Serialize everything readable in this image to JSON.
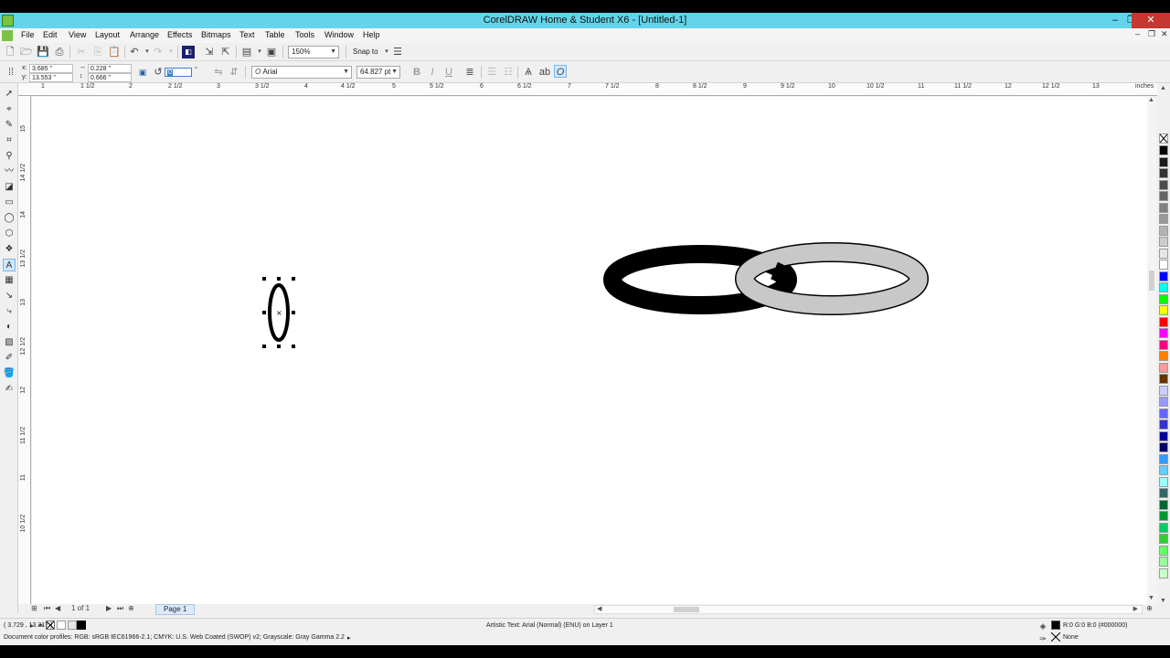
{
  "window": {
    "title": "CorelDRAW Home & Student X6 - [Untitled-1]",
    "minimize": "–",
    "restore": "❐",
    "close": "✕"
  },
  "menu": {
    "items": [
      "File",
      "Edit",
      "View",
      "Layout",
      "Arrange",
      "Effects",
      "Bitmaps",
      "Text",
      "Table",
      "Tools",
      "Window",
      "Help"
    ],
    "doc_minimize": "–",
    "doc_restore": "❐",
    "doc_close": "✕"
  },
  "standard_toolbar": {
    "zoom_level": "150%",
    "snap_to": "Snap to"
  },
  "property_bar": {
    "x": "3.685 \"",
    "y": "13.553 \"",
    "width": "0.228 \"",
    "height": "0.666 \"",
    "rotation": "0",
    "rotation_unit": "°",
    "font_name": "Arial",
    "font_size": "64.827 pt",
    "x_label": "x:",
    "y_label": "y:"
  },
  "rulers": {
    "horizontal_ticks": [
      "1",
      "1 1/2",
      "2",
      "2 1/2",
      "3",
      "3 1/2",
      "4",
      "4 1/2",
      "5",
      "5 1/2",
      "6",
      "6 1/2",
      "7",
      "7 1/2",
      "8",
      "8 1/2",
      "9",
      "9 1/2",
      "10",
      "10 1/2",
      "11",
      "11 1/2",
      "12",
      "12 1/2",
      "13"
    ],
    "unit": "inches",
    "vertical_ticks": [
      "15",
      "14 1/2",
      "14",
      "13 1/2",
      "13",
      "12 1/2",
      "12",
      "11 1/2",
      "11",
      "10 1/2"
    ]
  },
  "page_nav": {
    "page_count": "1 of 1",
    "page_tab": "Page 1"
  },
  "status": {
    "cursor_coords": "( 3.729 , 13.317 )",
    "object_info": "Artistic Text: Arial (Normal) (ENU) on Layer 1",
    "color_profiles": "Document color profiles: RGB: sRGB IEC61966-2.1; CMYK: U.S. Web Coated (SWOP) v2; Grayscale: Gray Gamma 2.2",
    "fill_color": "R:0 G:0 B:0 (#000000)",
    "outline": "None",
    "fill_swatch": "#000000"
  },
  "palette": {
    "colors": [
      "#000000",
      "#1a1a1a",
      "#333333",
      "#4d4d4d",
      "#666666",
      "#808080",
      "#999999",
      "#b3b3b3",
      "#cccccc",
      "#e6e6e6",
      "#ffffff",
      "#0000ff",
      "#00ffff",
      "#00ff00",
      "#ffff00",
      "#ff0000",
      "#ff00ff",
      "#ff0080",
      "#ff8000",
      "#ff9999",
      "#663300",
      "#ccccff",
      "#9999ff",
      "#6666ff",
      "#3333cc",
      "#000099",
      "#000066",
      "#3399ff",
      "#66ccff",
      "#99ffff",
      "#336666",
      "#006633",
      "#009933",
      "#00cc66",
      "#33cc33",
      "#66ff66",
      "#99ff99",
      "#ccffcc"
    ]
  }
}
